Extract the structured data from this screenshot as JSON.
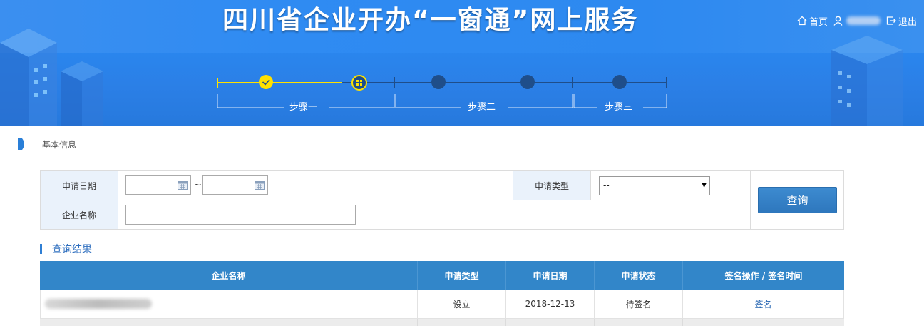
{
  "header": {
    "title": "四川省企业开办“一窗通”网上服务",
    "nav_home": "首页",
    "nav_logout": "退出"
  },
  "stepper": {
    "steps": [
      "步骤一",
      "步骤二",
      "步骤三"
    ],
    "completed_color": "#ffe100",
    "inactive_color": "#1f4e8a"
  },
  "breadcrumb": {
    "label": "基本信息"
  },
  "form": {
    "apply_date_label": "申请日期",
    "date_separator": "~",
    "apply_type_label": "申请类型",
    "apply_type_value": "--",
    "company_name_label": "企业名称",
    "search_button": "查询"
  },
  "results": {
    "title": "查询结果",
    "columns": [
      "企业名称",
      "申请类型",
      "申请日期",
      "申请状态",
      "签名操作 / 签名时间"
    ],
    "rows": [
      {
        "type": "设立",
        "date": "2018-12-13",
        "status": "待签名",
        "action": "签名"
      }
    ]
  },
  "colors": {
    "banner": "#2e8af0",
    "table_header": "#3286c9",
    "button": "#2e77bd",
    "link": "#2262b0"
  }
}
